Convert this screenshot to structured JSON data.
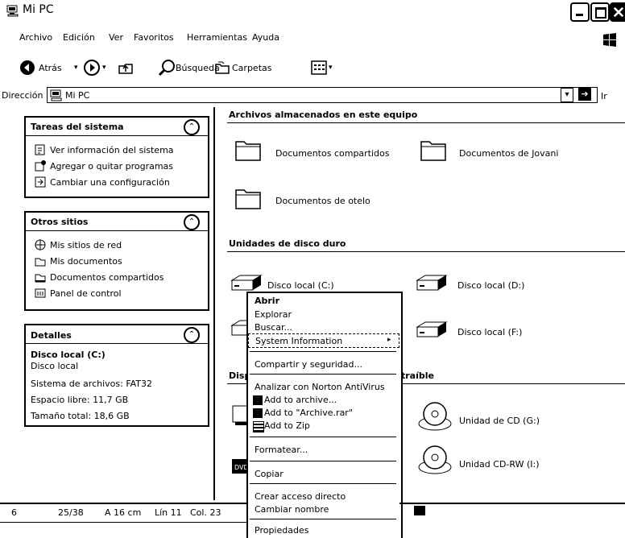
{
  "window": {
    "title": "Mi PC"
  },
  "menubar": [
    "Archivo",
    "Edición",
    "Ver",
    "Favoritos",
    "Herramientas",
    "Ayuda"
  ],
  "toolbar": {
    "back": "Atrás",
    "search": "Búsqueda",
    "folders": "Carpetas"
  },
  "address": {
    "label": "Dirección",
    "value": "Mi PC",
    "go": "Ir",
    "norton": "Norton AntiVirus"
  },
  "sidebar": {
    "system_tasks": {
      "title": "Tareas del sistema",
      "items": [
        "Ver información del sistema",
        "Agregar o quitar programas",
        "Cambiar una configuración"
      ]
    },
    "other_places": {
      "title": "Otros sitios",
      "items": [
        "Mis sitios de red",
        "Mis documentos",
        "Documentos compartidos",
        "Panel de control"
      ]
    },
    "details": {
      "title": "Detalles",
      "name": "Disco local (C:)",
      "type": "Disco local",
      "filesystem": "Sistema de archivos: FAT32",
      "free": "Espacio libre: 11,7 GB",
      "total": "Tamaño total: 18,6 GB"
    }
  },
  "main": {
    "files_section": "Archivos almacenados en este equipo",
    "folders": [
      "Documentos compartidos",
      "Documentos de Jovani",
      "Documentos de otelo"
    ],
    "hdd_section": "Unidades de disco duro",
    "drives": [
      "Disco local (C:)",
      "Disco local (D:)",
      "Disco local (F:)"
    ],
    "removable_section_prefix": "Disp",
    "removable_section_suffix": "traíble",
    "removable": [
      "Unidad de CD (G:)",
      "Unidad CD-RW (I:)"
    ]
  },
  "context_menu": {
    "items": [
      "Abrir",
      "Explorar",
      "Buscar...",
      "System Information",
      "Compartir y seguridad...",
      "Analizar con Norton AntiVirus",
      "Add to archive...",
      "Add to \"Archive.rar\"",
      "Add to Zip",
      "Formatear...",
      "Copiar",
      "Crear acceso directo",
      "Cambiar nombre",
      "Propiedades"
    ]
  },
  "statusbar": {
    "page": "6",
    "pages": "25/38",
    "at": "A 16 cm",
    "line": "Lín 11",
    "col": "Col. 23"
  }
}
